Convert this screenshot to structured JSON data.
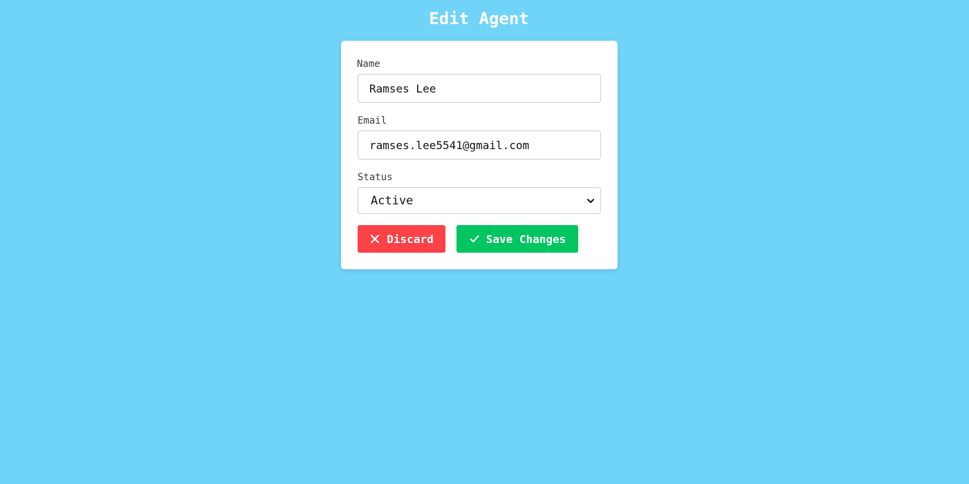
{
  "page": {
    "title": "Edit Agent"
  },
  "form": {
    "name_label": "Name",
    "name_value": "Ramses Lee",
    "email_label": "Email",
    "email_value": "ramses.lee5541@gmail.com",
    "status_label": "Status",
    "status_value": "Active"
  },
  "actions": {
    "discard_label": "Discard",
    "discard_icon": "close-icon",
    "save_label": "Save Changes",
    "save_icon": "check-icon"
  },
  "colors": {
    "background": "#70d3f8",
    "discard": "#fb4247",
    "save": "#00c560"
  }
}
